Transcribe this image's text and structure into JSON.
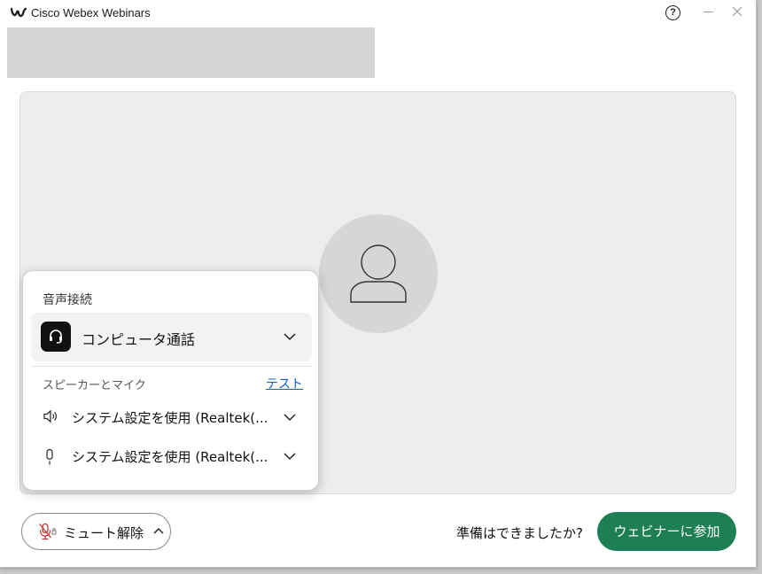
{
  "window": {
    "title": "Cisco Webex Webinars",
    "help_symbol": "?"
  },
  "audio_popup": {
    "title": "音声接続",
    "connection_option": "コンピュータ通話",
    "speaker_mic_heading": "スピーカーとマイク",
    "test_link": "テスト",
    "speaker_device": "システム設定を使用 (Realtek(...",
    "microphone_device": "システム設定を使用 (Realtek(..."
  },
  "bottom_bar": {
    "unmute_label": "ミュート解除",
    "ready_prompt": "準備はできましたか?",
    "join_label": "ウェビナーに参加"
  },
  "colors": {
    "join_button": "#1e7e54",
    "link": "#0b62c4",
    "muted_mic": "#c43a3a"
  },
  "icons": {
    "logo": "webex-logo-icon",
    "connection": "headset-icon",
    "speaker": "speaker-icon",
    "microphone": "microphone-icon",
    "muted_mic": "muted-microphone-icon",
    "avatar": "person-icon"
  }
}
